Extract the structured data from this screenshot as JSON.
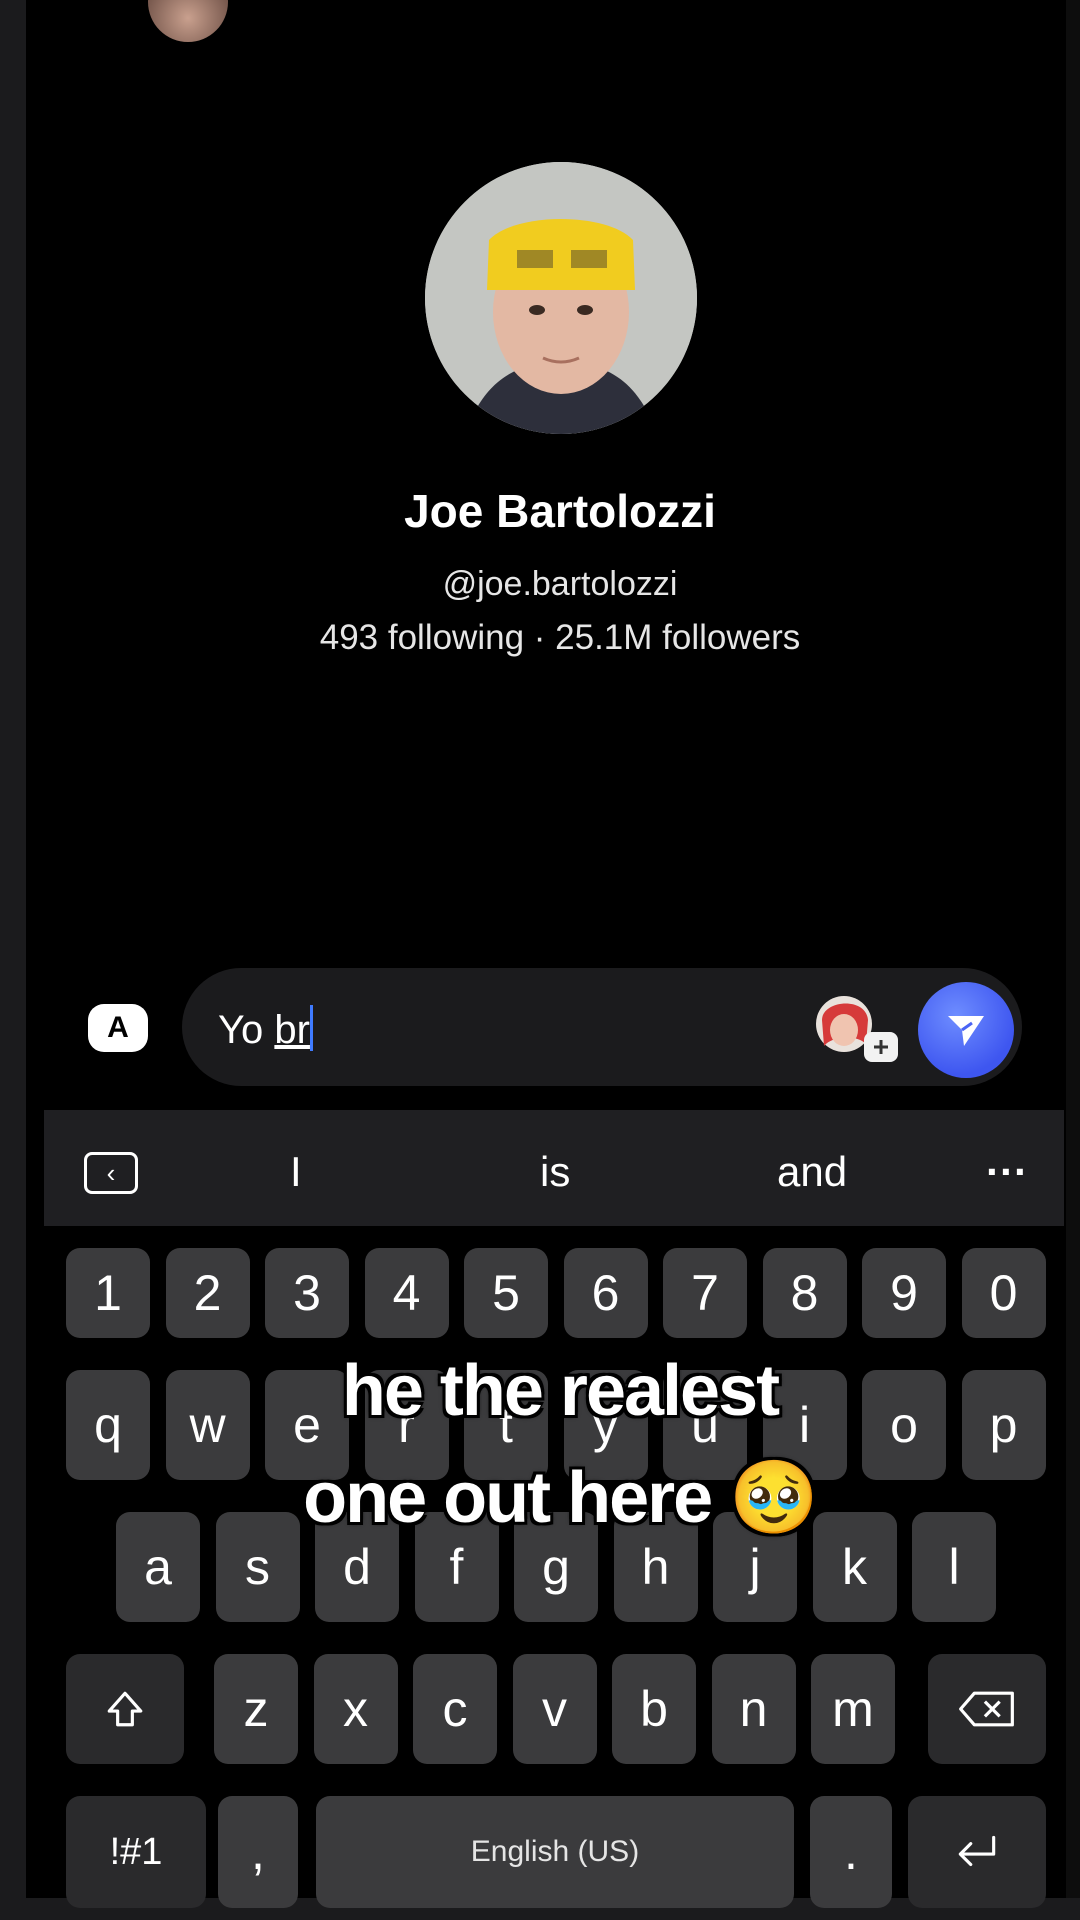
{
  "profile": {
    "name": "Joe Bartolozzi",
    "handle": "@joe.bartolozzi",
    "stats": "493 following · 25.1M followers"
  },
  "message": {
    "text_before": "Yo ",
    "text_underlined": "br",
    "keyboard_toggle": "A",
    "send_icon": "send-icon",
    "sticker_icon": "sticker-add-icon"
  },
  "keyboard": {
    "suggestions": [
      "I",
      "is",
      "and"
    ],
    "more": "···",
    "numbers": [
      "1",
      "2",
      "3",
      "4",
      "5",
      "6",
      "7",
      "8",
      "9",
      "0"
    ],
    "row1": [
      "q",
      "w",
      "e",
      "r",
      "t",
      "y",
      "u",
      "i",
      "o",
      "p"
    ],
    "row2": [
      "a",
      "s",
      "d",
      "f",
      "g",
      "h",
      "j",
      "k",
      "l"
    ],
    "row3": [
      "z",
      "x",
      "c",
      "v",
      "b",
      "n",
      "m"
    ],
    "symbols_label": "!#1",
    "comma": ",",
    "space_label": "English (US)",
    "period": "."
  },
  "overlay": {
    "line1": "he the realest",
    "line2": "one out here 🥹"
  }
}
